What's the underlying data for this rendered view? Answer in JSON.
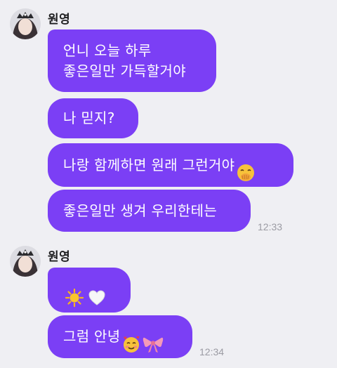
{
  "groups": [
    {
      "sender": "원영",
      "messages": [
        "언니 오늘 하루\n좋은일만 가득할거야",
        "나 믿지?",
        "나랑 함께하면 원래 그런거야",
        "좋은일만 생겨 우리한테는"
      ],
      "time": "12:33"
    },
    {
      "sender": "원영",
      "messages": [
        "",
        "그럼 안녕"
      ],
      "time": "12:34"
    }
  ],
  "emojis": [
    "hand-over-mouth-face",
    "sun",
    "white-heart",
    "smiling-face-with-hearts",
    "ribbon-bow"
  ],
  "colors": {
    "bubble": "#7b3ff5",
    "background": "#efeff3",
    "text": "#ffffff",
    "timestamp": "#9b9ba3"
  }
}
